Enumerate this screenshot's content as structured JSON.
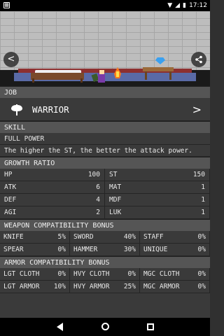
{
  "status_bar": {
    "time": "17:12"
  },
  "scene": {
    "left_nav": "<",
    "right_nav": "share"
  },
  "job": {
    "header": "JOB",
    "name": "WARRIOR",
    "icon": "axe-icon"
  },
  "skill": {
    "header": "SKILL",
    "name": "FULL POWER",
    "description": "The higher the ST, the better the attack power."
  },
  "growth": {
    "header": "GROWTH RATIO",
    "stats": [
      {
        "label": "HP",
        "value": "100"
      },
      {
        "label": "ST",
        "value": "150"
      },
      {
        "label": "ATK",
        "value": "6"
      },
      {
        "label": "MAT",
        "value": "1"
      },
      {
        "label": "DEF",
        "value": "4"
      },
      {
        "label": "MDF",
        "value": "1"
      },
      {
        "label": "AGI",
        "value": "2"
      },
      {
        "label": "LUK",
        "value": "1"
      }
    ]
  },
  "weapon": {
    "header": "WEAPON COMPATIBILITY BONUS",
    "items": [
      {
        "label": "KNIFE",
        "value": "5%"
      },
      {
        "label": "SWORD",
        "value": "40%"
      },
      {
        "label": "STAFF",
        "value": "0%"
      },
      {
        "label": "SPEAR",
        "value": "0%"
      },
      {
        "label": "HAMMER",
        "value": "30%"
      },
      {
        "label": "UNIQUE",
        "value": "0%"
      }
    ]
  },
  "armor": {
    "header": "ARMOR COMPATIBILITY BONUS",
    "items": [
      {
        "label": "LGT CLOTH",
        "value": "0%"
      },
      {
        "label": "HVY CLOTH",
        "value": "0%"
      },
      {
        "label": "MGC CLOTH",
        "value": "0%"
      },
      {
        "label": "LGT ARMOR",
        "value": "10%"
      },
      {
        "label": "HVY ARMOR",
        "value": "25%"
      },
      {
        "label": "MGC ARMOR",
        "value": "0%"
      }
    ]
  },
  "colors": {
    "header_bg": "#555555",
    "panel_bg": "#3a3a3a",
    "text": "#e8e8e8"
  }
}
